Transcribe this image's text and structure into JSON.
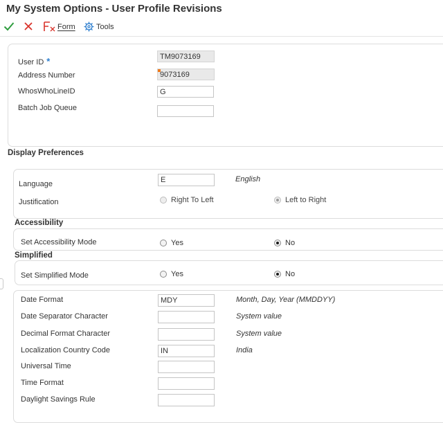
{
  "window": {
    "title": "My System Options - User Profile Revisions"
  },
  "toolbar": {
    "form_label": "Form",
    "tools_label": "Tools"
  },
  "user": {
    "user_id": {
      "label": "User ID",
      "value": "TM9073169"
    },
    "address_number": {
      "label": "Address Number",
      "value": "9073169"
    },
    "whoswho": {
      "label": "WhosWhoLineID",
      "value": "G"
    },
    "batch_queue": {
      "label": "Batch Job Queue",
      "value": ""
    }
  },
  "display_prefs": {
    "title": "Display Preferences",
    "language": {
      "label": "Language",
      "value": "E",
      "desc": "English"
    },
    "justification": {
      "label": "Justification",
      "option1": "Right To Left",
      "option2": "Left to Right",
      "selected": "Left to Right"
    }
  },
  "accessibility": {
    "title": "Accessibility",
    "mode": {
      "label": "Set Accessibility Mode",
      "yes": "Yes",
      "no": "No",
      "selected": "No"
    }
  },
  "simplified": {
    "title": "Simplified",
    "mode": {
      "label": "Set Simplified Mode",
      "yes": "Yes",
      "no": "No",
      "selected": "No"
    }
  },
  "formats": {
    "date_format": {
      "label": "Date Format",
      "value": "MDY",
      "desc": "Month, Day, Year (MMDDYY)"
    },
    "date_separator": {
      "label": "Date Separator Character",
      "value": "",
      "desc": "System value"
    },
    "decimal_format": {
      "label": "Decimal Format Character",
      "value": "",
      "desc": "System value"
    },
    "country_code": {
      "label": "Localization Country Code",
      "value": "IN",
      "desc": "India"
    },
    "universal_time": {
      "label": "Universal Time",
      "value": ""
    },
    "time_format": {
      "label": "Time Format",
      "value": ""
    },
    "daylight_savings": {
      "label": "Daylight Savings Rule",
      "value": ""
    }
  },
  "colors": {
    "ok": "#2e9d3e",
    "cancel": "#d9322a",
    "required": "#2f7fcf"
  }
}
